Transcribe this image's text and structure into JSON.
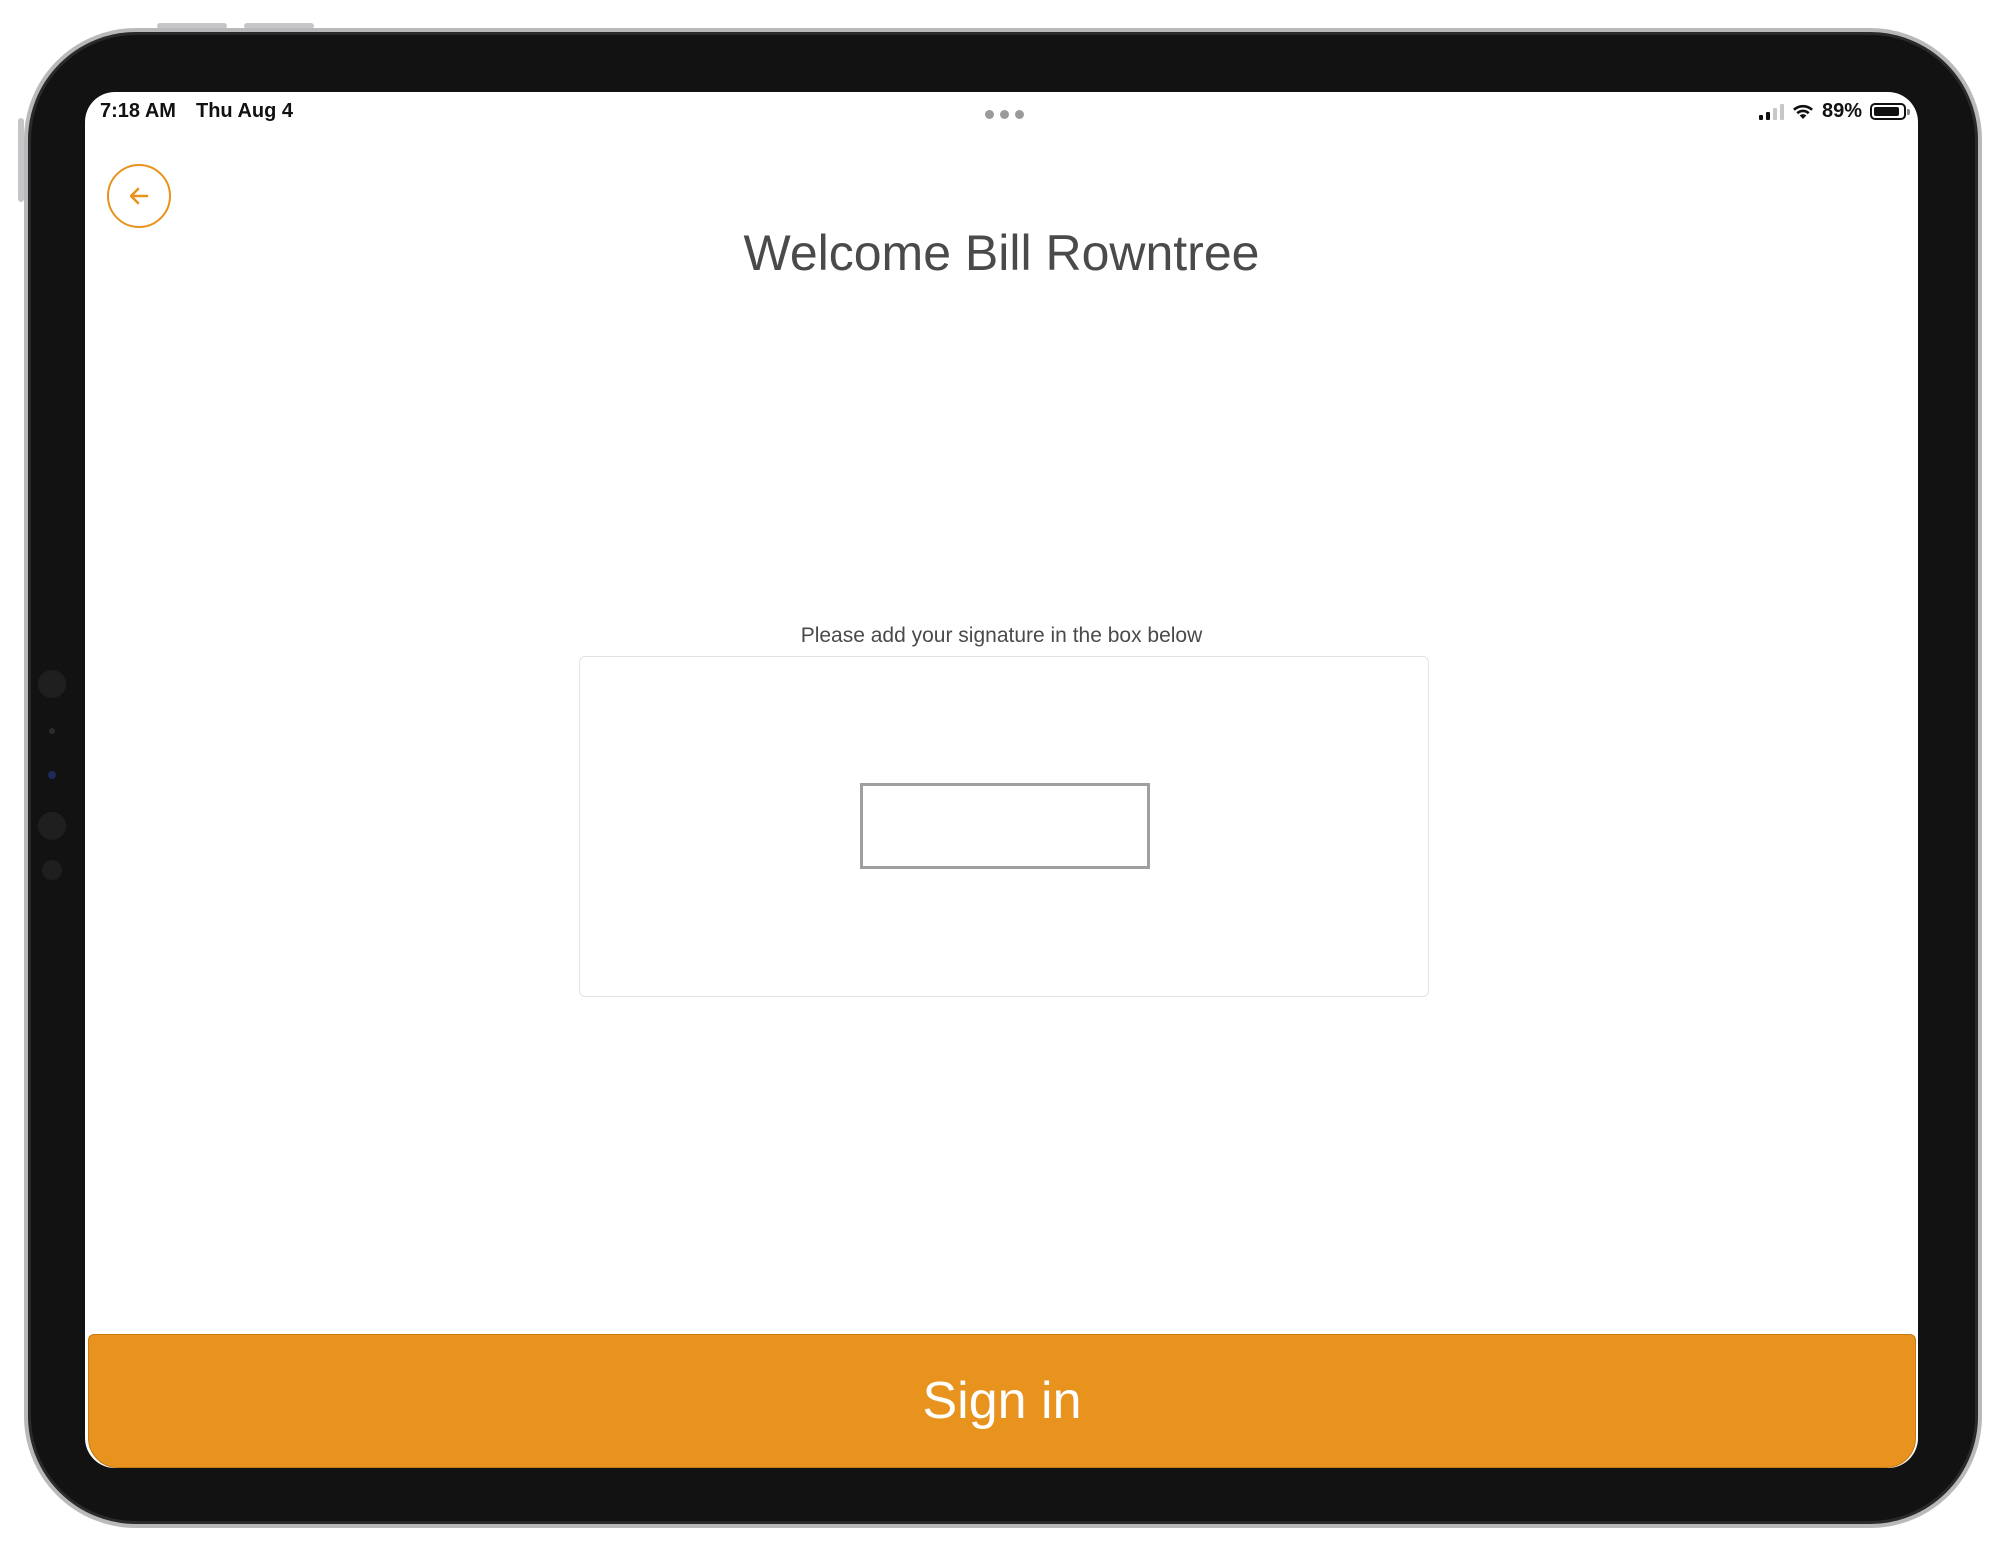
{
  "status_bar": {
    "time": "7:18 AM",
    "date": "Thu Aug 4",
    "battery_percent": "89%",
    "battery_level": 0.89,
    "icons": [
      "cellular-signal-icon",
      "wifi-icon",
      "battery-icon"
    ]
  },
  "header": {
    "back_icon": "arrow-left-icon",
    "title": "Welcome Bill Rowntree"
  },
  "signature": {
    "instruction": "Please add your signature in the box below"
  },
  "footer": {
    "sign_in_label": "Sign in"
  },
  "colors": {
    "accent": "#e7931e",
    "title_text": "#4a4a4d",
    "background": "#ffffff"
  }
}
